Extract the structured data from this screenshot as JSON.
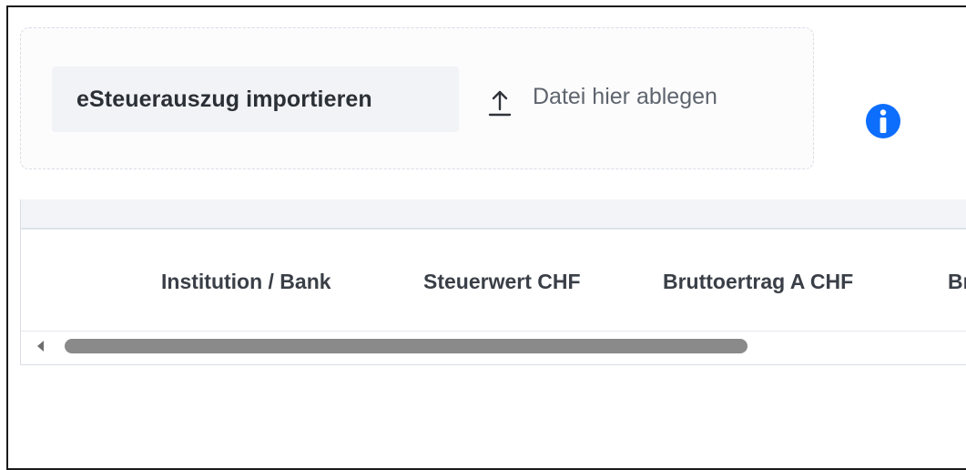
{
  "import": {
    "button_label": "eSteuerauszug importieren",
    "drop_text": "Datei hier ablegen",
    "upload_icon": "upload-icon",
    "info_icon": "info-icon"
  },
  "table": {
    "columns": [
      "Institution / Bank",
      "Steuerwert CHF",
      "Bruttoertrag A CHF",
      "Br"
    ]
  },
  "scrollbar": {
    "thumb_fraction": 0.75
  },
  "colors": {
    "info_blue": "#0d6efd",
    "button_bg": "#f1f3f6",
    "border": "#1a1a1a"
  }
}
